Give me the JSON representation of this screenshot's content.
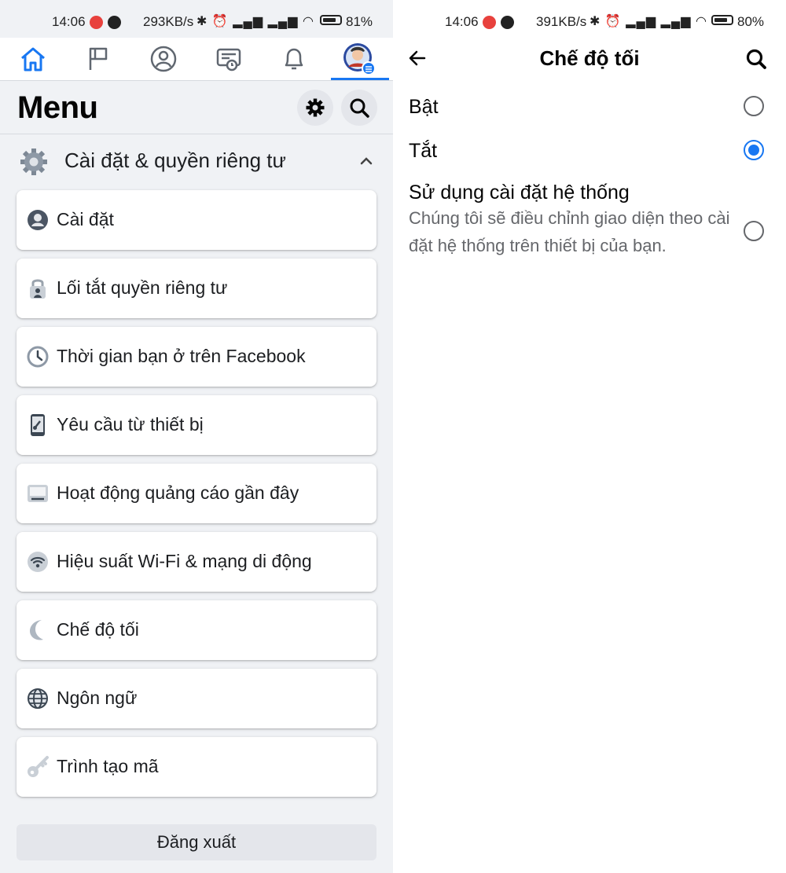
{
  "left": {
    "status_bar": {
      "time": "14:06",
      "speed": "293KB/s",
      "battery": "81%",
      "battery_level": 0.81
    },
    "menu_title": "Menu",
    "section": {
      "label": "Cài đặt & quyền riêng tư"
    },
    "items": [
      {
        "label": "Cài đặt",
        "icon": "account-icon"
      },
      {
        "label": "Lối tắt quyền riêng tư",
        "icon": "lock-icon"
      },
      {
        "label": "Thời gian bạn ở trên Facebook",
        "icon": "clock-icon"
      },
      {
        "label": "Yêu cầu từ thiết bị",
        "icon": "phone-icon"
      },
      {
        "label": "Hoạt động quảng cáo gần đây",
        "icon": "ad-activity-icon"
      },
      {
        "label": "Hiệu suất Wi-Fi & mạng di động",
        "icon": "wifi-icon"
      },
      {
        "label": "Chế độ tối",
        "icon": "moon-icon"
      },
      {
        "label": "Ngôn ngữ",
        "icon": "globe-icon"
      },
      {
        "label": "Trình tạo mã",
        "icon": "key-icon"
      }
    ],
    "logout_label": "Đăng xuất"
  },
  "right": {
    "status_bar": {
      "time": "14:06",
      "speed": "391KB/s",
      "battery": "80%",
      "battery_level": 0.8
    },
    "title": "Chế độ tối",
    "options": [
      {
        "label": "Bật",
        "selected": false
      },
      {
        "label": "Tắt",
        "selected": true
      },
      {
        "label": "Sử dụng cài đặt hệ thống",
        "description": "Chúng tôi sẽ điều chỉnh giao diện theo cài đặt hệ thống trên thiết bị của bạn.",
        "selected": false
      }
    ]
  },
  "colors": {
    "accent": "#1877f2",
    "background": "#f0f2f5",
    "card": "#ffffff",
    "secondary_text": "#65676b"
  }
}
